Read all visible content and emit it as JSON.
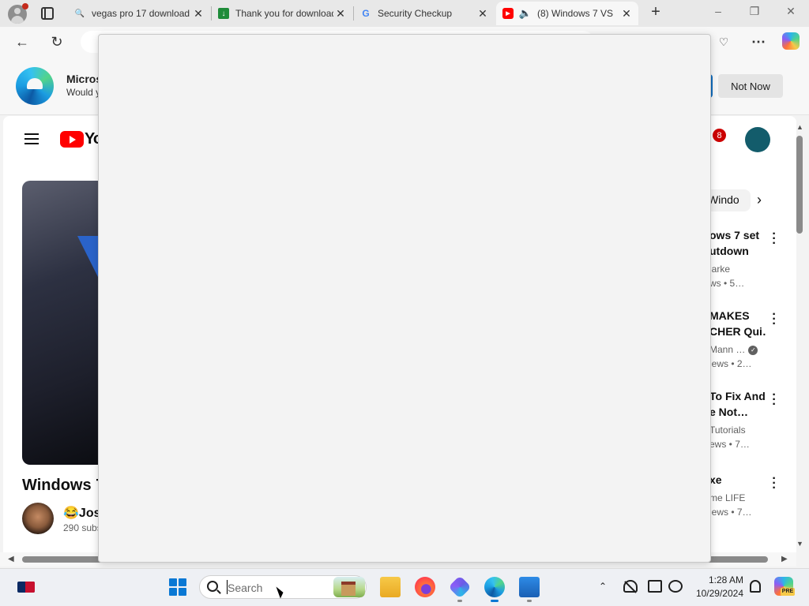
{
  "browser": {
    "tabs": [
      {
        "title": "vegas pro 17 download",
        "favicon": "search-icon",
        "active": false
      },
      {
        "title": "Thank you for download",
        "favicon": "download-site-icon",
        "active": false
      },
      {
        "title": "Security Checkup",
        "favicon": "google-icon",
        "active": false
      },
      {
        "title": "(8) Windows 7 VS",
        "favicon": "youtube-icon",
        "active": true,
        "audio": true
      }
    ],
    "window_controls": {
      "minimize": "–",
      "restore": "❐",
      "close": "✕"
    },
    "new_tab": "+"
  },
  "infobar": {
    "title": "Micros",
    "subtitle": "Would y",
    "not_now_label": "Not Now"
  },
  "youtube": {
    "logo_text": "Yo",
    "notification_count": "8",
    "video_title": "Windows 7",
    "channel_name": "😂Jos",
    "channel_subs": "290 subs",
    "chip_label": "Windo",
    "recommendations": [
      {
        "title1": "ows 7 set",
        "title2": "utdown",
        "meta1": "larke",
        "meta2": "ws • 5…",
        "verified": false
      },
      {
        "title1": "MAKES",
        "title2": "CHER Qui…",
        "meta1": "Mann …",
        "meta2": "iews • 2…",
        "verified": true
      },
      {
        "title1": "To Fix And",
        "title2": "e Not…",
        "meta1": "Tutorials",
        "meta2": "ews • 7…",
        "verified": false
      },
      {
        "title1": "xe",
        "title2": "",
        "meta1": "me LIFE",
        "meta2": "iews • 7…",
        "verified": false
      }
    ]
  },
  "taskbar": {
    "search_placeholder": "Search",
    "time": "1:28 AM",
    "date": "10/29/2024",
    "copilot_badge": "PRE"
  },
  "colors": {
    "youtube_red": "#ff0000",
    "edge_blue": "#0f6cbd",
    "overlay_bg": "#f3f3f3"
  }
}
